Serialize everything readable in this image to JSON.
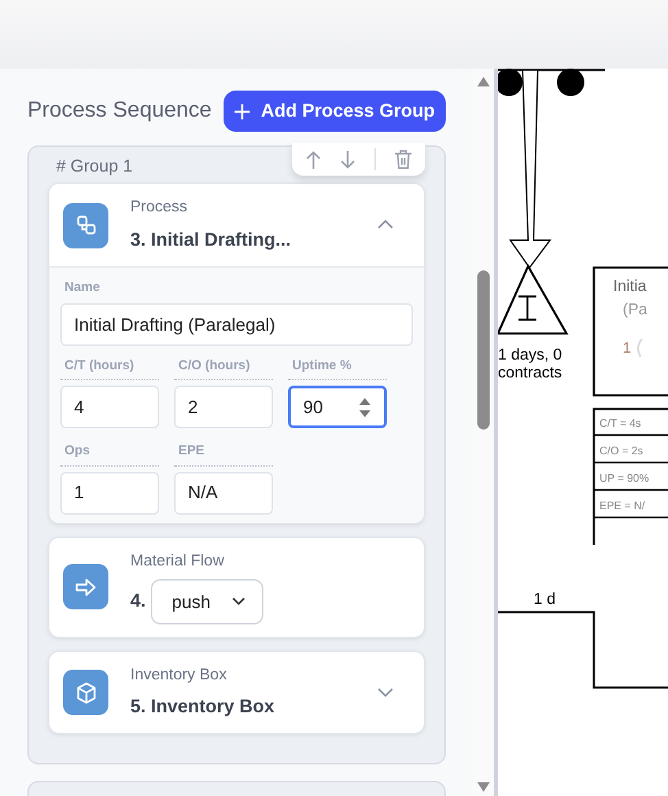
{
  "panel": {
    "title": "Process Sequence",
    "add_button": "Add Process Group"
  },
  "groups": [
    {
      "title": "# Group 1",
      "items": [
        {
          "kind": "process",
          "type_label": "Process",
          "title": "3. Initial Drafting...",
          "expanded": true,
          "name_field": {
            "label": "Name",
            "value": "Initial Drafting (Paralegal)"
          },
          "metrics": [
            {
              "label": "C/T (hours)",
              "value": "4",
              "focused": false
            },
            {
              "label": "C/O (hours)",
              "value": "2",
              "focused": false
            },
            {
              "label": "Uptime %",
              "value": "90",
              "focused": true
            },
            {
              "label": "Ops",
              "value": "1",
              "focused": false
            },
            {
              "label": "EPE",
              "value": "N/A",
              "focused": false
            }
          ]
        },
        {
          "kind": "flow",
          "type_label": "Material Flow",
          "number": "4.",
          "value": "push"
        },
        {
          "kind": "inventory",
          "type_label": "Inventory Box",
          "title": "5. Inventory Box",
          "expanded": false
        }
      ]
    }
  ],
  "canvas": {
    "inventory_label": [
      "1 days, 0",
      "contracts"
    ],
    "process_title": [
      "Initia",
      "(Pa"
    ],
    "operators": "1",
    "data_rows": [
      "C/T = 4s",
      "C/O = 2s",
      "UP = 90%",
      "EPE = N/"
    ],
    "timeline": "1 d"
  }
}
